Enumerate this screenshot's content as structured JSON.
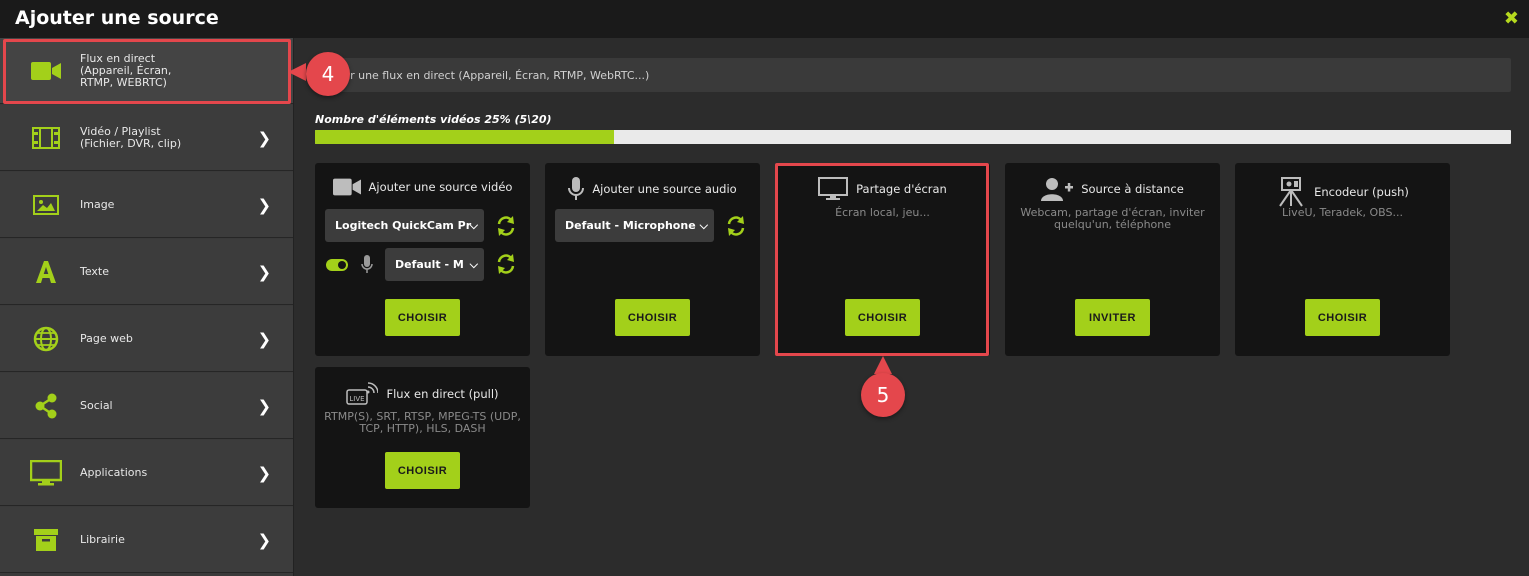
{
  "window": {
    "title": "Ajouter une source",
    "close_glyph": "✖"
  },
  "sidebar": {
    "items": [
      {
        "label_lines": [
          "Flux en direct",
          "(Appareil, Écran,",
          "RTMP, WEBRTC)"
        ],
        "icon": "video-camera-icon"
      },
      {
        "label_lines": [
          "Vidéo / Playlist",
          "(Fichier, DVR, clip)"
        ],
        "icon": "film-icon"
      },
      {
        "label_lines": [
          "Image"
        ],
        "icon": "image-icon"
      },
      {
        "label_lines": [
          "Texte"
        ],
        "icon": "letter-a-icon"
      },
      {
        "label_lines": [
          "Page web"
        ],
        "icon": "globe-icon"
      },
      {
        "label_lines": [
          "Social"
        ],
        "icon": "share-icon"
      },
      {
        "label_lines": [
          "Applications"
        ],
        "icon": "monitor-icon"
      },
      {
        "label_lines": [
          "Librairie"
        ],
        "icon": "archive-box-icon"
      }
    ],
    "chevron": "❯"
  },
  "annotations": {
    "badge_4": "4",
    "badge_5": "5"
  },
  "search": {
    "text": "ter une flux en direct (Appareil, Écran, RTMP, WebRTC...)"
  },
  "progress": {
    "label": "Nombre d'éléments vidéos 25% (5\\20)",
    "fraction": 0.25
  },
  "cards": {
    "video": {
      "title": "Ajouter une source vidéo",
      "device": "Logitech QuickCam Pr",
      "audio": "Default - M",
      "button": "CHOISIR"
    },
    "audio": {
      "title": "Ajouter une source audio",
      "device": "Default - Microphone",
      "button": "CHOISIR"
    },
    "screen": {
      "title": "Partage d'écran",
      "desc": "Écran local, jeu...",
      "button": "CHOISIR"
    },
    "remote": {
      "title": "Source à distance",
      "desc": "Webcam, partage d'écran, inviter quelqu'un, téléphone",
      "button": "INVITER"
    },
    "encoder": {
      "title": "Encodeur (push)",
      "desc": "LiveU, Teradek, OBS...",
      "button": "CHOISIR"
    },
    "pull": {
      "title": "Flux en direct (pull)",
      "desc": "RTMP(S), SRT, RTSP, MPEG-TS (UDP, TCP, HTTP), HLS, DASH",
      "button": "CHOISIR",
      "icon_text": "LIVE"
    }
  },
  "colors": {
    "accent": "#a3d01a",
    "highlight": "#e4474c",
    "card_bg": "#141414"
  }
}
